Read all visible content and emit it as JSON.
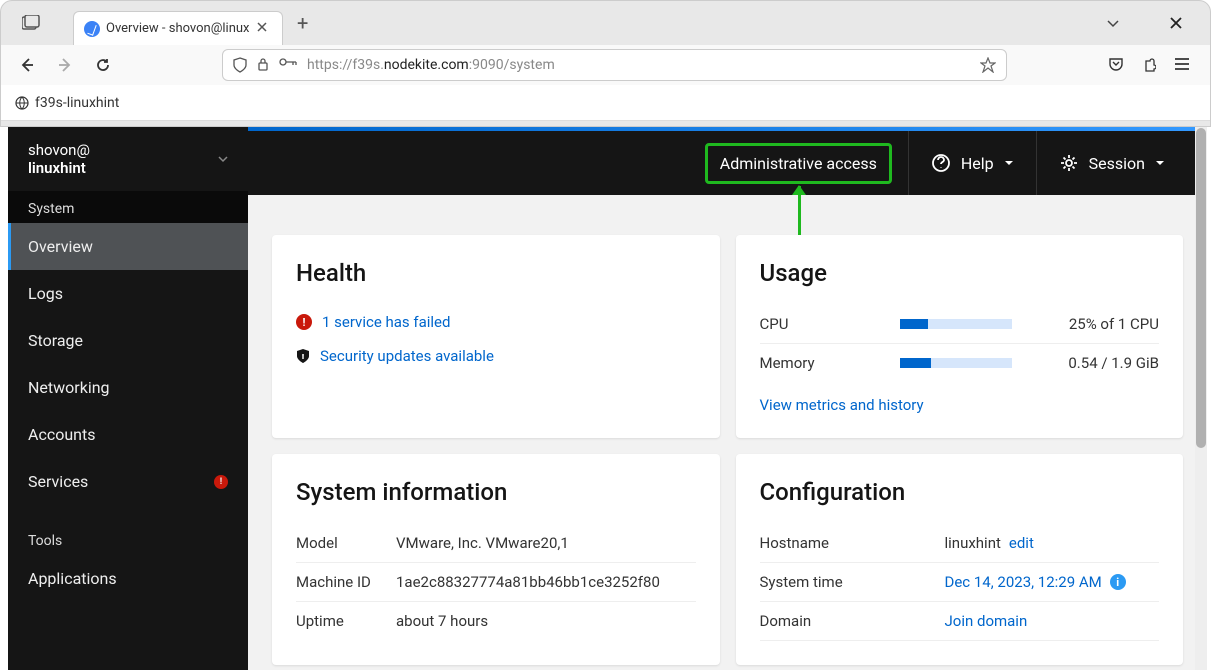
{
  "browser": {
    "tab_title": "Overview - shovon@linux",
    "url_prefix": "https://f39s.",
    "url_host": "nodekite.com",
    "url_suffix": ":9090/system",
    "bookmark": "f39s-linuxhint"
  },
  "sidebar": {
    "user_at": "shovon@",
    "user_host": "linuxhint",
    "section1": "System",
    "items": [
      {
        "label": "Overview"
      },
      {
        "label": "Logs"
      },
      {
        "label": "Storage"
      },
      {
        "label": "Networking"
      },
      {
        "label": "Accounts"
      },
      {
        "label": "Services",
        "badge": "!"
      }
    ],
    "section2": "Tools",
    "items2": [
      {
        "label": "Applications"
      }
    ]
  },
  "topbar": {
    "admin": "Administrative access",
    "help": "Help",
    "session": "Session"
  },
  "health": {
    "title": "Health",
    "failed": "1 service has failed",
    "security": "Security updates available"
  },
  "usage": {
    "title": "Usage",
    "cpu_label": "CPU",
    "cpu_text": "25% of 1 CPU",
    "cpu_pct": 25,
    "mem_label": "Memory",
    "mem_text": "0.54 / 1.9 GiB",
    "mem_pct": 28,
    "metrics": "View metrics and history"
  },
  "sysinfo": {
    "title": "System information",
    "rows": [
      {
        "label": "Model",
        "value": "VMware, Inc. VMware20,1"
      },
      {
        "label": "Machine ID",
        "value": "1ae2c88327774a81bb46bb1ce3252f80"
      },
      {
        "label": "Uptime",
        "value": "about 7 hours"
      }
    ]
  },
  "config": {
    "title": "Configuration",
    "hostname_label": "Hostname",
    "hostname_value": "linuxhint",
    "edit": "edit",
    "systime_label": "System time",
    "systime_value": "Dec 14, 2023, 12:29 AM",
    "domain_label": "Domain",
    "domain_value": "Join domain"
  }
}
